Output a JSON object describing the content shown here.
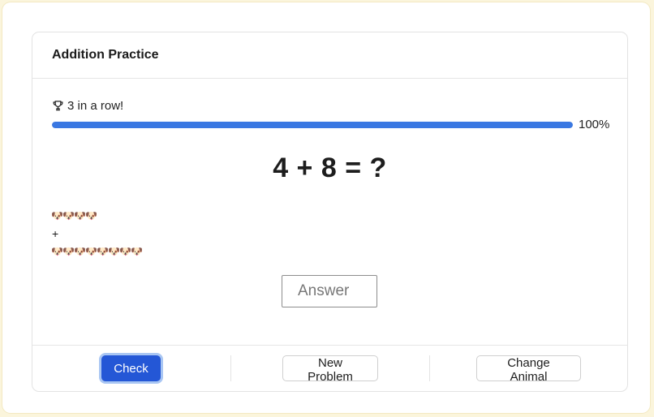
{
  "header": {
    "title": "Addition Practice"
  },
  "streak": {
    "icon": "trophy-icon",
    "text": "3 in a row!"
  },
  "progress": {
    "value_percent": 100,
    "label": "100%",
    "color": "#3a78e2"
  },
  "problem": {
    "text": "4 + 8 = ?",
    "addend_a": 4,
    "addend_b": 8
  },
  "visual": {
    "animal": "🐶",
    "row_a_count": 4,
    "plus": "+",
    "row_b_count": 8
  },
  "answer": {
    "placeholder": "Answer",
    "value": ""
  },
  "footer": {
    "check_label": "Check",
    "new_problem_label": "New Problem",
    "change_animal_label": "Change Animal"
  },
  "colors": {
    "primary": "#2457d6",
    "background": "#fbf5dc"
  }
}
